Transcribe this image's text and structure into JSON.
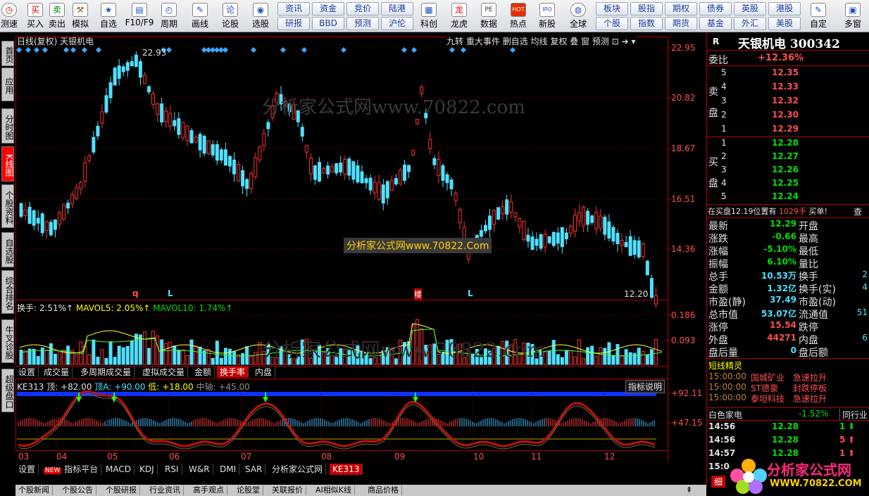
{
  "toolbar": {
    "items": [
      {
        "label": "测速",
        "icon": "clock-icon"
      },
      {
        "label": "买入",
        "icon": "buy-icon",
        "glyph": "买"
      },
      {
        "label": "卖出",
        "icon": "sell-icon",
        "glyph": "卖"
      },
      {
        "label": "模拟",
        "icon": "hammer-icon",
        "glyph": "⚒"
      },
      {
        "label": "自选",
        "icon": "star-icon",
        "glyph": "★"
      },
      {
        "label": "F10/F9",
        "icon": "f10-icon",
        "glyph": "▤"
      },
      {
        "label": "周期",
        "icon": "period-icon",
        "glyph": "◴"
      },
      {
        "label": "画线",
        "icon": "pencil-icon",
        "glyph": "✎"
      },
      {
        "label": "论股",
        "icon": "discuss-icon",
        "glyph": "论"
      },
      {
        "label": "选股",
        "icon": "select-icon",
        "glyph": "◉"
      },
      {
        "label": "科创",
        "icon": "kechuang-icon",
        "glyph": "▦"
      },
      {
        "label": "龙虎",
        "icon": "dragon-icon",
        "glyph": "龙"
      },
      {
        "label": "数据",
        "icon": "pe-icon",
        "glyph": "PE"
      },
      {
        "label": "热点",
        "icon": "hot-icon",
        "glyph": "HOT"
      },
      {
        "label": "新股",
        "icon": "ipo-icon",
        "glyph": "IPO"
      },
      {
        "label": "全球",
        "icon": "globe-icon",
        "glyph": "◍"
      },
      {
        "label": "自定",
        "icon": "edit-icon",
        "glyph": "✎"
      },
      {
        "label": "多窗",
        "icon": "window-icon",
        "glyph": "▣"
      }
    ],
    "buttons_row1": [
      "资讯",
      "资金",
      "竞价",
      "陆港"
    ],
    "buttons_row2": [
      "研报",
      "BBD",
      "预测",
      "沪伦"
    ],
    "buttons_right_row1": [
      "板块",
      "股指",
      "期权",
      "债券",
      "英股",
      "港股"
    ],
    "buttons_right_row2": [
      "个股",
      "指数",
      "期货",
      "基金",
      "外汇",
      "美股"
    ]
  },
  "left_tabs": [
    "首页",
    "应用",
    "分时图",
    "K线图",
    "个股资料",
    "自选股",
    "综合排名",
    "牛叉诊股",
    "超级盘口"
  ],
  "chart_header": {
    "title": "日线(复权)  天银机电",
    "menu": [
      "九转",
      "重大事件",
      "删自选",
      "均线",
      "复权",
      "叠",
      "窗",
      "预测"
    ]
  },
  "watermark": "分析家公式网www.70822.com",
  "watermark2": "分析家公式网www.70822.Com",
  "price_axis": [
    "22.95",
    "20.82",
    "18.67",
    "16.51",
    "14.36"
  ],
  "price_high": "22.93",
  "price_low": "12.20",
  "kline_marks": [
    "q",
    "L",
    "楼",
    "L"
  ],
  "volume": {
    "legend_hs": "换手: 2.51%↑",
    "legend_ma5": "MAVOL5: 2.05%↑",
    "legend_ma10": "MAVOL10: 1.74%↑",
    "axis": [
      "0.186",
      "0.093"
    ],
    "tabs": [
      "设置",
      "成交量",
      "多周期成交量",
      "虚拟成交量",
      "金额",
      "换手率",
      "内盘"
    ]
  },
  "indicator": {
    "name": "KE313",
    "top": "顶: +82.00",
    "mid": "顶A: +90.00",
    "low": "低: +18.00",
    "axis_mid": "中轴: +45.00",
    "explain": "指标说明",
    "axis": [
      "+92.11",
      "+47.15"
    ],
    "tabs": [
      "设置",
      "指标平台",
      "MACD",
      "KDJ",
      "RSI",
      "W&R",
      "DMI",
      "SAR",
      "分析家公式网",
      "KE313"
    ],
    "new_badge": "NEW"
  },
  "months": [
    "03",
    "04",
    "05",
    "06",
    "07",
    "08",
    "09",
    "10",
    "11",
    "12"
  ],
  "info_tabs": [
    "个股新闻",
    "个股公告",
    "个股研报",
    "行业资讯",
    "高手观点",
    "论股堂",
    "关联报价",
    "AI相似K线",
    "商品价格"
  ],
  "right": {
    "title": "天银机电 300342",
    "r_badge": "R",
    "weibi_label": "委比",
    "weibi": "+12.36%",
    "sell_label": "卖盘",
    "buy_label": "买盘",
    "sell": [
      {
        "n": "5",
        "p": "12.35"
      },
      {
        "n": "4",
        "p": "12.33"
      },
      {
        "n": "3",
        "p": "12.32"
      },
      {
        "n": "2",
        "p": "12.30"
      },
      {
        "n": "1",
        "p": "12.29"
      }
    ],
    "buy": [
      {
        "n": "1",
        "p": "12.28"
      },
      {
        "n": "2",
        "p": "12.27"
      },
      {
        "n": "3",
        "p": "12.26"
      },
      {
        "n": "4",
        "p": "12.25"
      },
      {
        "n": "5",
        "p": "12.24"
      }
    ],
    "notice": "在买盘12.19位置有",
    "notice_vol": "1029手",
    "notice_act": "买单!",
    "notice_q": "查",
    "stats": [
      {
        "k": "最新",
        "v": "12.29",
        "k2": "开盘"
      },
      {
        "k": "涨跌",
        "v": "-0.66",
        "k2": "最高"
      },
      {
        "k": "涨幅",
        "v": "-5.10%",
        "k2": "最低"
      },
      {
        "k": "振幅",
        "v": "6.10%",
        "k2": "量比"
      },
      {
        "k": "总手",
        "v": "10.53万",
        "k2": "换手",
        "v2": "2"
      },
      {
        "k": "金额",
        "v": "1.32亿",
        "k2": "换手(实)",
        "v2": "4"
      },
      {
        "k": "市盈(静)",
        "v": "37.49",
        "k2": "市盈(动)"
      },
      {
        "k": "总市值",
        "v": "53.07亿",
        "k2": "流通值",
        "v2": "51"
      },
      {
        "k": "涨停",
        "v": "15.54",
        "k2": "跌停"
      },
      {
        "k": "外盘",
        "v": "44271",
        "k2": "内盘",
        "v2": "6"
      },
      {
        "k": "盘后量",
        "v": "0",
        "k2": "盘后额"
      }
    ],
    "sprite_title": "短线精灵",
    "sprites": [
      {
        "t": "15:00:00",
        "n": "国城矿业",
        "a": "急速拉升"
      },
      {
        "t": "15:00:00",
        "n": "ST德豪",
        "a": "封跌停板"
      },
      {
        "t": "15:00:00",
        "n": "泰坦科技",
        "a": "急速拉升"
      }
    ],
    "sector": "白色家电",
    "sector_pct": "-1.52%",
    "sector_tab": "同行业",
    "ticks": [
      {
        "t": "14:56",
        "p": "12.28",
        "v": "1",
        "d": "down"
      },
      {
        "t": "14:56",
        "p": "12.28",
        "v": "5",
        "d": "up"
      },
      {
        "t": "14:57",
        "p": "12.28",
        "v": "1",
        "d": "up"
      },
      {
        "t": "15:0",
        "p": "",
        "v": "",
        "d": ""
      }
    ],
    "detail_tab": "细"
  },
  "logo": {
    "line1": "分析家公式网",
    "line2": "WWW.70822.COM"
  }
}
